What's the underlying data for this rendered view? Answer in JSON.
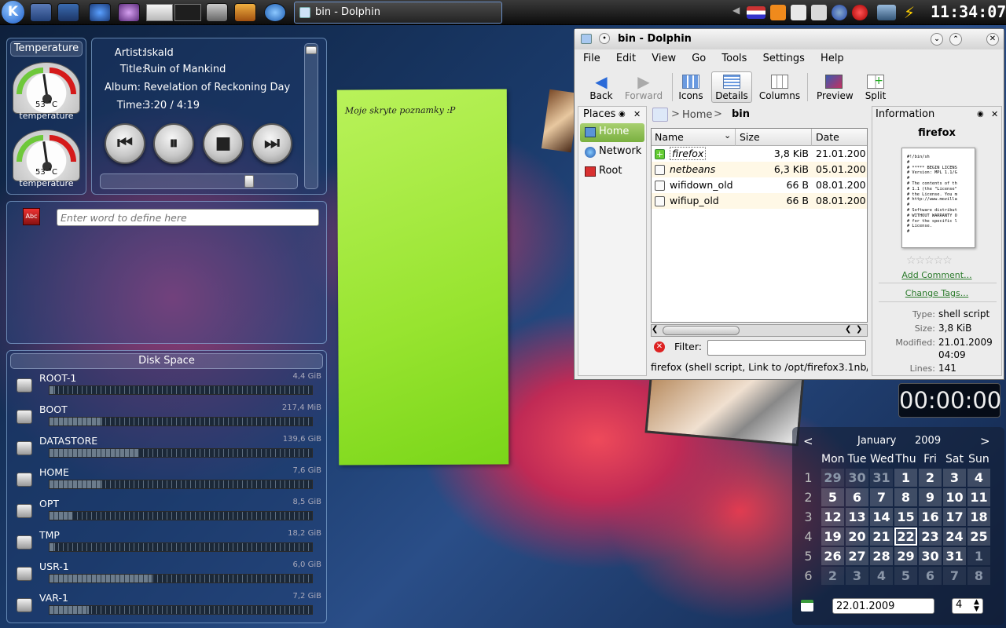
{
  "panel": {
    "task_title": "bin - Dolphin",
    "clock": "11:34:07"
  },
  "temperature": {
    "title": "Temperature",
    "gauges": [
      {
        "value": "53 °C",
        "label": "temperature"
      },
      {
        "value": "53 °C",
        "label": "temperature"
      }
    ]
  },
  "nowplaying": {
    "artist_label": "Artist:",
    "artist": "Iskald",
    "title_label": "Title:",
    "title": "Ruin of Mankind",
    "album_label": "Album:",
    "album": "Revelation of Reckoning Day",
    "time_label": "Time:",
    "time": "3:20 / 4:19",
    "progress": 0.77
  },
  "dictionary": {
    "placeholder": "Enter word to define here"
  },
  "note": {
    "text": "Moje skryte poznamky :P"
  },
  "diskspace": {
    "title": "Disk Space",
    "disks": [
      {
        "name": "ROOT-1",
        "size": "4,4 GiB",
        "used": 0.02
      },
      {
        "name": "BOOT",
        "size": "217,4 MiB",
        "used": 0.2
      },
      {
        "name": "DATASTORE",
        "size": "139,6 GiB",
        "used": 0.34
      },
      {
        "name": "HOME",
        "size": "7,6 GiB",
        "used": 0.2
      },
      {
        "name": "OPT",
        "size": "8,5 GiB",
        "used": 0.09
      },
      {
        "name": "TMP",
        "size": "18,2 GiB",
        "used": 0.02
      },
      {
        "name": "USR-1",
        "size": "6,0 GiB",
        "used": 0.39
      },
      {
        "name": "VAR-1",
        "size": "7,2 GiB",
        "used": 0.15
      }
    ]
  },
  "dolphin": {
    "title": "bin - Dolphin",
    "menu": [
      "File",
      "Edit",
      "View",
      "Go",
      "Tools",
      "Settings",
      "Help"
    ],
    "toolbar": {
      "back": "Back",
      "forward": "Forward",
      "icons": "Icons",
      "details": "Details",
      "columns": "Columns",
      "preview": "Preview",
      "split": "Split"
    },
    "places": {
      "title": "Places",
      "items": [
        "Home",
        "Network",
        "Root"
      ]
    },
    "breadcrumb": {
      "home": "Home",
      "current": "bin"
    },
    "columns": {
      "name": "Name",
      "size": "Size",
      "date": "Date"
    },
    "files": [
      {
        "name": "firefox",
        "size": "3,8 KiB",
        "date": "21.01.200"
      },
      {
        "name": "netbeans",
        "size": "6,3 KiB",
        "date": "05.01.200"
      },
      {
        "name": "wifidown_old",
        "size": "66 B",
        "date": "08.01.200"
      },
      {
        "name": "wifiup_old",
        "size": "66 B",
        "date": "08.01.200"
      }
    ],
    "filter_label": "Filter:",
    "statusbar": "firefox (shell script, Link to /opt/firefox3.1nb/",
    "info": {
      "title": "Information",
      "name": "firefox",
      "preview": [
        "#!/bin/sh",
        "#",
        "# ***** BEGIN LICENS",
        "# Version: MPL 1.1/G",
        "#",
        "# The contents of th",
        "# 1.1 (the \"License\"",
        "# the License. You m",
        "# http://www.mozilla",
        "#",
        "# Software distribut",
        "# WITHOUT WARRANTY O",
        "# for the specific l",
        "# License.",
        "#"
      ],
      "add_comment": "Add Comment...",
      "change_tags": "Change Tags...",
      "type_label": "Type:",
      "type": "shell script",
      "size_label": "Size:",
      "size": "3,8 KiB",
      "modified_label": "Modified:",
      "modified": "21.01.2009",
      "modified_time": "04:09",
      "lines_label": "Lines:",
      "lines": "141"
    }
  },
  "timer": {
    "value": "00:00:00"
  },
  "calendar": {
    "prev": "<",
    "next": ">",
    "month": "January",
    "year": "2009",
    "weekdays": [
      "Mon",
      "Tue",
      "Wed",
      "Thu",
      "Fri",
      "Sat",
      "Sun"
    ],
    "weeks": [
      {
        "wk": "1",
        "days": [
          "29",
          "30",
          "31",
          "1",
          "2",
          "3",
          "4"
        ]
      },
      {
        "wk": "2",
        "days": [
          "5",
          "6",
          "7",
          "8",
          "9",
          "10",
          "11"
        ]
      },
      {
        "wk": "3",
        "days": [
          "12",
          "13",
          "14",
          "15",
          "16",
          "17",
          "18"
        ]
      },
      {
        "wk": "4",
        "days": [
          "19",
          "20",
          "21",
          "22",
          "23",
          "24",
          "25"
        ]
      },
      {
        "wk": "5",
        "days": [
          "26",
          "27",
          "28",
          "29",
          "30",
          "31",
          "1"
        ]
      },
      {
        "wk": "6",
        "days": [
          "2",
          "3",
          "4",
          "5",
          "6",
          "7",
          "8"
        ]
      }
    ],
    "date_field": "22.01.2009",
    "week_spin": "4"
  }
}
